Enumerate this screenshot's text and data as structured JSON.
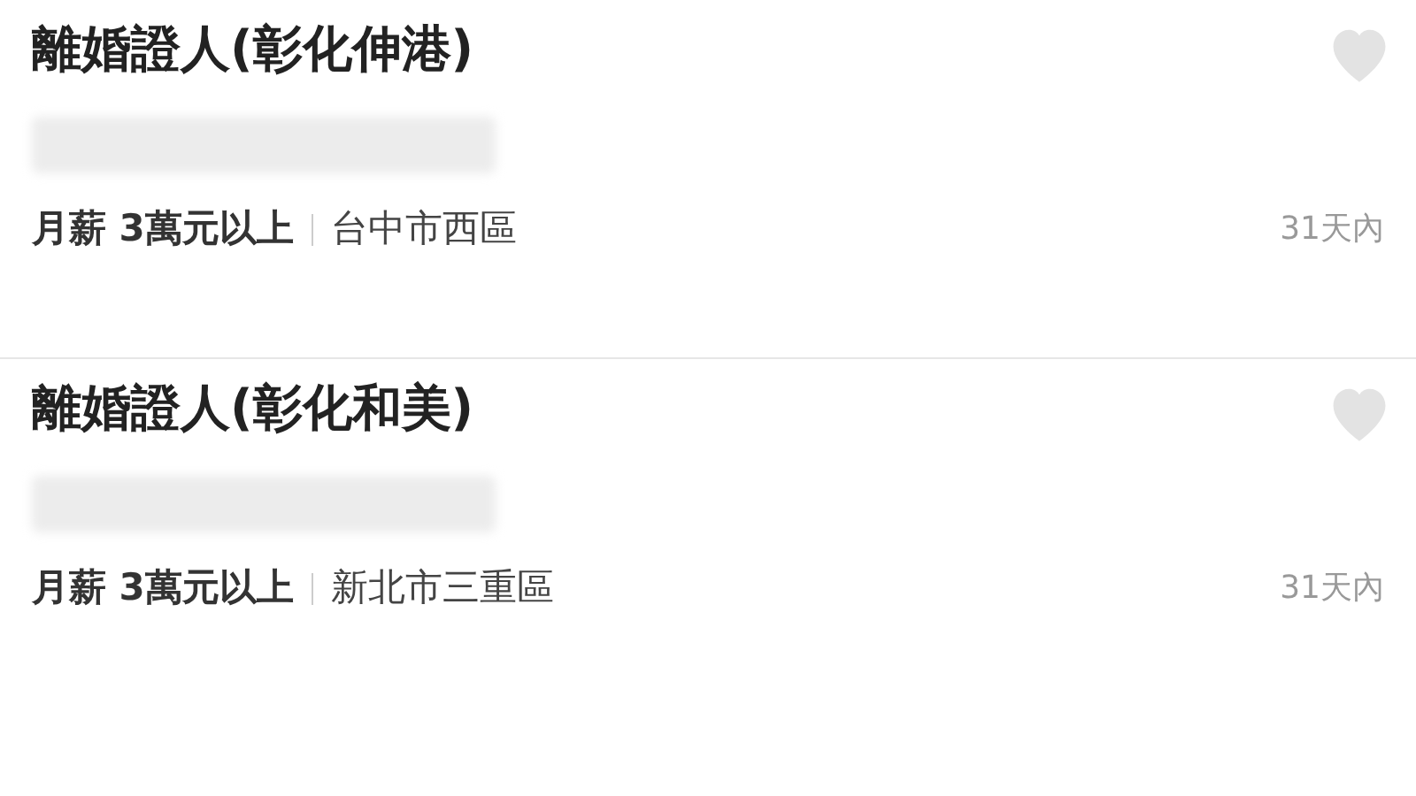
{
  "jobs": [
    {
      "title": "離婚證人(彰化伸港)",
      "salary": "月薪 3萬元以上",
      "location": "台中市西區",
      "posted": "31天內"
    },
    {
      "title": "離婚證人(彰化和美)",
      "salary": "月薪 3萬元以上",
      "location": "新北市三重區",
      "posted": "31天內"
    }
  ]
}
